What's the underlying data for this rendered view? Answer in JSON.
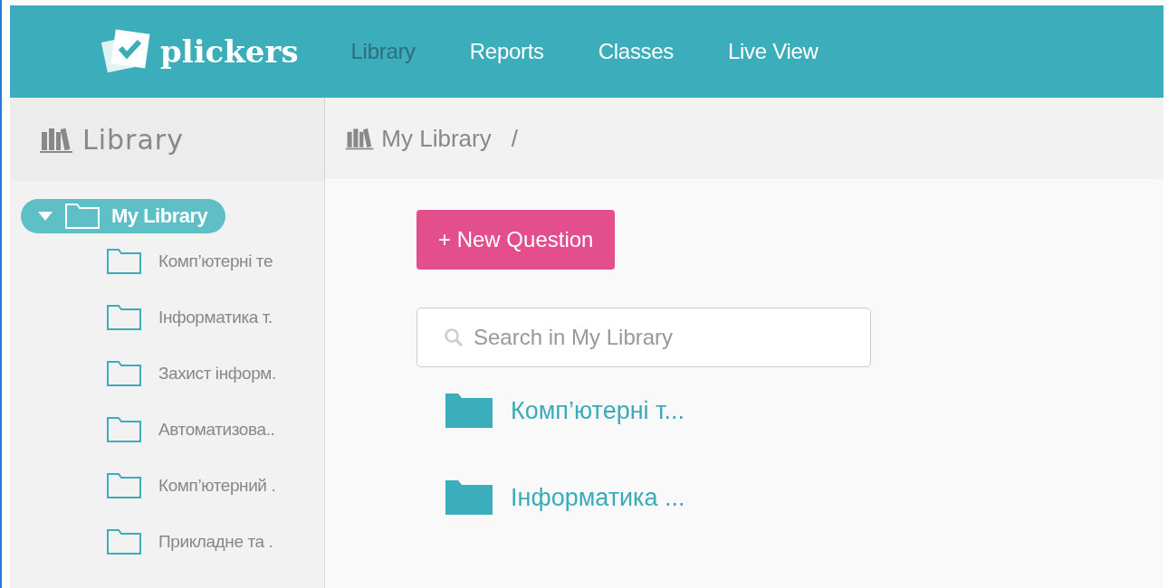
{
  "header": {
    "logo": "plickers",
    "nav": [
      {
        "label": "Library",
        "selected": true
      },
      {
        "label": "Reports",
        "selected": false
      },
      {
        "label": "Classes",
        "selected": false
      },
      {
        "label": "Live View",
        "selected": false
      }
    ]
  },
  "sidebar": {
    "title": "Library",
    "tree": [
      {
        "label": "My Library",
        "selected": true,
        "expanded": true,
        "children": [
          {
            "label": "Комп’ютерні те",
            "selected": false
          },
          {
            "label": "Інформатика т.",
            "selected": false
          },
          {
            "label": "Захист інформ.",
            "selected": false
          },
          {
            "label": "Автоматизова..",
            "selected": false
          },
          {
            "label": "Комп’ютерний .",
            "selected": false
          },
          {
            "label": "Прикладне та .",
            "selected": false
          }
        ]
      }
    ]
  },
  "main": {
    "breadcrumb": [
      {
        "label": "My Library"
      },
      {
        "label": "/"
      }
    ],
    "new_button": "+ New Question",
    "search": {
      "placeholder": "Search in My Library"
    },
    "folders": [
      {
        "label": "Комп’ютерні т..."
      },
      {
        "label": "Інформатика ..."
      }
    ]
  }
}
